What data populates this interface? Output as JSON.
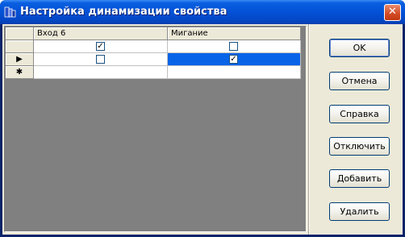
{
  "window": {
    "title": "Настройка динамизации свойства",
    "close_glyph": "✕"
  },
  "grid": {
    "columns": [
      "Вход 6",
      "Мигание"
    ],
    "rows": [
      {
        "indicator": "",
        "values": [
          true,
          false
        ],
        "selected": false
      },
      {
        "indicator": "▶",
        "values": [
          false,
          true
        ],
        "selected": true
      },
      {
        "indicator": "✱",
        "values": [
          null,
          null
        ],
        "selected": false
      }
    ]
  },
  "buttons": {
    "ok": "OK",
    "cancel": "Отмена",
    "help": "Справка",
    "disable": "Отключить",
    "add": "Добавить",
    "delete": "Удалить"
  },
  "colors": {
    "selection": "#0a64e8",
    "titlebar": "#0453d8",
    "face": "#ece9d8"
  },
  "icons": {
    "app": "app-icon",
    "close": "close-icon"
  }
}
